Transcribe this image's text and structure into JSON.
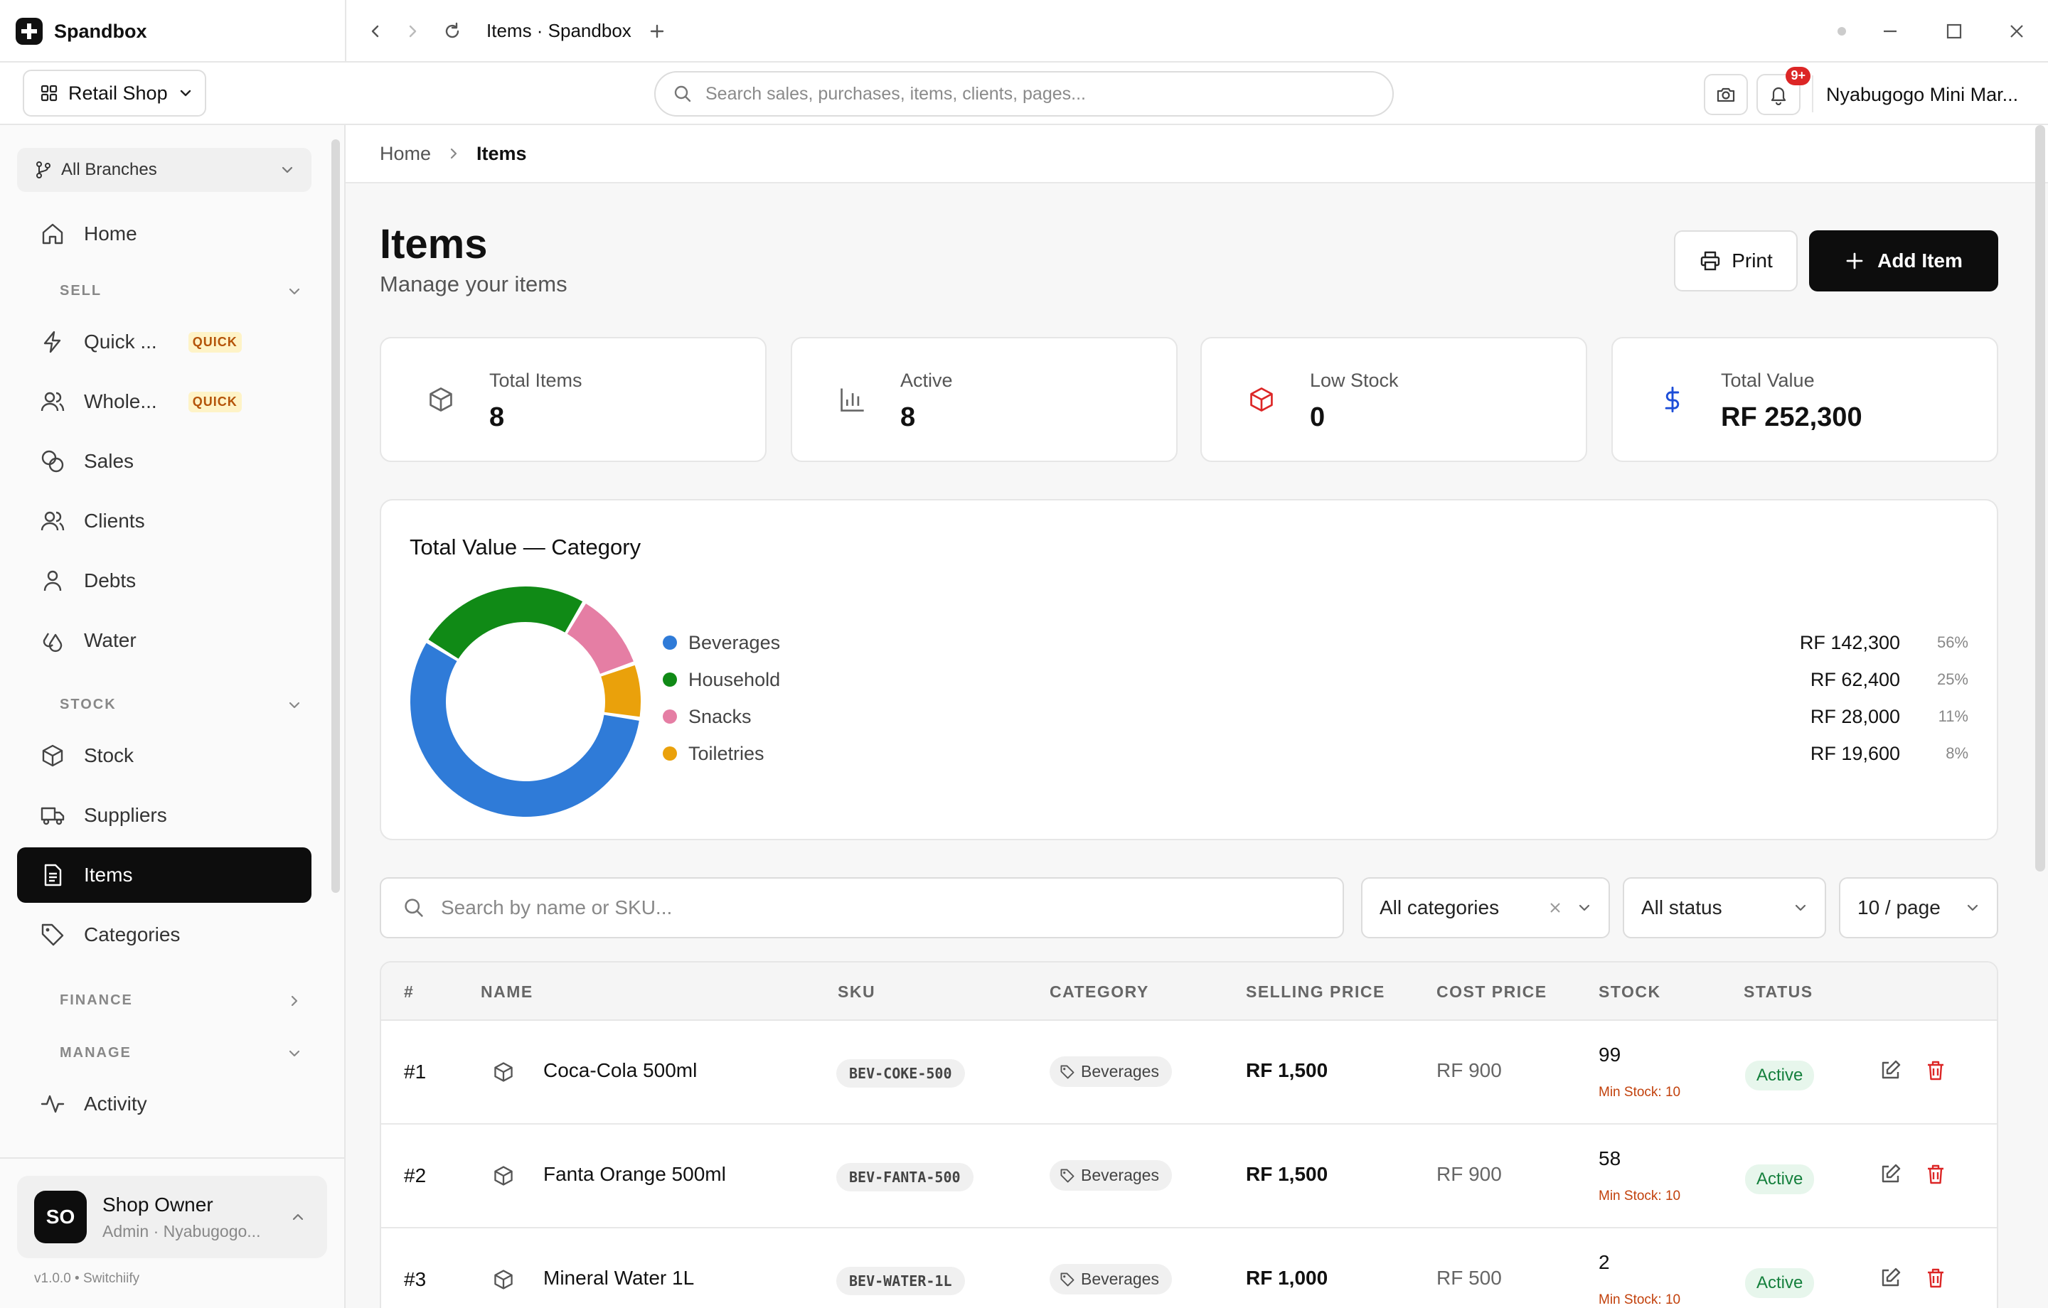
{
  "window": {
    "app_name": "Spandbox",
    "tab_title": "Items · Spandbox"
  },
  "topbar": {
    "shop_switcher": "Retail Shop",
    "search_placeholder": "Search sales, purchases, items, clients, pages...",
    "notification_count": "9+",
    "org_name": "Nyabugogo Mini Mar..."
  },
  "sidebar": {
    "branch_selector": "All Branches",
    "home": "Home",
    "section_sell": "SELL",
    "quick_sale": "Quick ...",
    "wholesale": "Whole...",
    "quick_badge": "QUICK",
    "sales": "Sales",
    "clients": "Clients",
    "debts": "Debts",
    "water": "Water",
    "section_stock": "STOCK",
    "stock": "Stock",
    "suppliers": "Suppliers",
    "items": "Items",
    "categories": "Categories",
    "section_finance": "FINANCE",
    "section_manage": "MANAGE",
    "activity": "Activity",
    "profile_initials": "SO",
    "profile_name": "Shop Owner",
    "profile_role": "Admin · Nyabugogo...",
    "version": "v1.0.0 • Switchiify"
  },
  "breadcrumb": {
    "home": "Home",
    "current": "Items"
  },
  "page": {
    "title": "Items",
    "subtitle": "Manage your items",
    "print_label": "Print",
    "add_label": "Add Item"
  },
  "stats": {
    "total_items_label": "Total Items",
    "total_items_value": "8",
    "active_label": "Active",
    "active_value": "8",
    "low_stock_label": "Low Stock",
    "low_stock_value": "0",
    "total_value_label": "Total Value",
    "total_value_value": "RF 252,300"
  },
  "chart_data": {
    "type": "pie",
    "title": "Total Value — Category",
    "categories": [
      "Beverages",
      "Household",
      "Snacks",
      "Toiletries"
    ],
    "values": [
      142300,
      62400,
      28000,
      19600
    ],
    "value_labels": [
      "RF 142,300",
      "RF 62,400",
      "RF 28,000",
      "RF 19,600"
    ],
    "percent_labels": [
      "56%",
      "25%",
      "11%",
      "8%"
    ],
    "colors": [
      "#2f7bd8",
      "#108a16",
      "#e57ea4",
      "#eaa10b"
    ],
    "donut": true,
    "legend": "right"
  },
  "filters": {
    "search_placeholder": "Search by name or SKU...",
    "category": "All categories",
    "status": "All status",
    "page_size": "10 / page"
  },
  "table": {
    "headers": [
      "#",
      "NAME",
      "SKU",
      "CATEGORY",
      "SELLING PRICE",
      "COST PRICE",
      "STOCK",
      "STATUS"
    ],
    "rows": [
      {
        "num": "#1",
        "name": "Coca-Cola 500ml",
        "sku": "BEV-COKE-500",
        "category": "Beverages",
        "selling_price": "RF 1,500",
        "cost_price": "RF 900",
        "stock": "99",
        "min_stock": "Min Stock: 10",
        "status": "Active"
      },
      {
        "num": "#2",
        "name": "Fanta Orange 500ml",
        "sku": "BEV-FANTA-500",
        "category": "Beverages",
        "selling_price": "RF 1,500",
        "cost_price": "RF 900",
        "stock": "58",
        "min_stock": "Min Stock: 10",
        "status": "Active"
      },
      {
        "num": "#3",
        "name": "Mineral Water 1L",
        "sku": "BEV-WATER-1L",
        "category": "Beverages",
        "selling_price": "RF 1,000",
        "cost_price": "RF 500",
        "stock": "2",
        "min_stock": "Min Stock: 10",
        "status": "Active"
      }
    ]
  }
}
